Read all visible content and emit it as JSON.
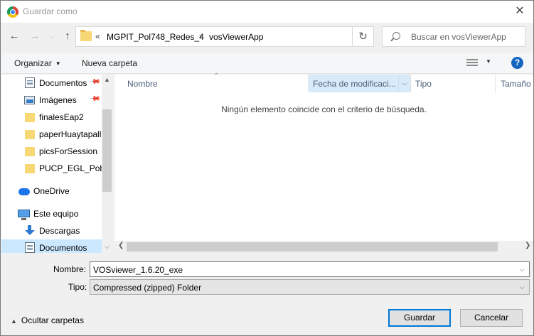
{
  "window": {
    "title": "Guardar como",
    "close_glyph": "✕"
  },
  "nav": {
    "back_icon": "arrow-left-icon",
    "forward_icon": "arrow-right-icon",
    "recent_icon": "chevron-down-icon",
    "up_icon": "arrow-up-icon"
  },
  "address": {
    "overflow": "«",
    "crumbs": [
      "MGPIT_Pol748_Redes_4",
      "vosViewerApp"
    ],
    "separator": "›",
    "refresh_glyph": "↻"
  },
  "search": {
    "placeholder": "Buscar en vosViewerApp"
  },
  "toolbar": {
    "organize_label": "Organizar",
    "new_folder_label": "Nueva carpeta",
    "help_label": "?"
  },
  "sidebar": {
    "items": [
      {
        "label": "Documentos",
        "icon": "document-icon",
        "pinned": true
      },
      {
        "label": "Imágenes",
        "icon": "pictures-icon",
        "pinned": true
      },
      {
        "label": "finalesEap2",
        "icon": "folder-icon"
      },
      {
        "label": "paperHuaytapall",
        "icon": "folder-icon"
      },
      {
        "label": "picsForSession",
        "icon": "folder-icon"
      },
      {
        "label": "PUCP_EGL_Pobr",
        "icon": "folder-icon"
      },
      {
        "label": "OneDrive",
        "icon": "onedrive-icon"
      },
      {
        "label": "Este equipo",
        "icon": "computer-icon"
      },
      {
        "label": "Descargas",
        "icon": "downloads-icon"
      },
      {
        "label": "Documentos",
        "icon": "document-icon",
        "selected": true
      }
    ]
  },
  "columns": {
    "name": "Nombre",
    "modified": "Fecha de modificaci...",
    "type": "Tipo",
    "size": "Tamaño"
  },
  "empty_message": "Ningún elemento coincide con el criterio de búsqueda.",
  "form": {
    "name_label": "Nombre:",
    "name_value": "VOSviewer_1.6.20_exe",
    "type_label": "Tipo:",
    "type_value": "Compressed (zipped) Folder"
  },
  "footer": {
    "hide_folders_label": "Ocultar carpetas",
    "save_label": "Guardar",
    "cancel_label": "Cancelar"
  }
}
